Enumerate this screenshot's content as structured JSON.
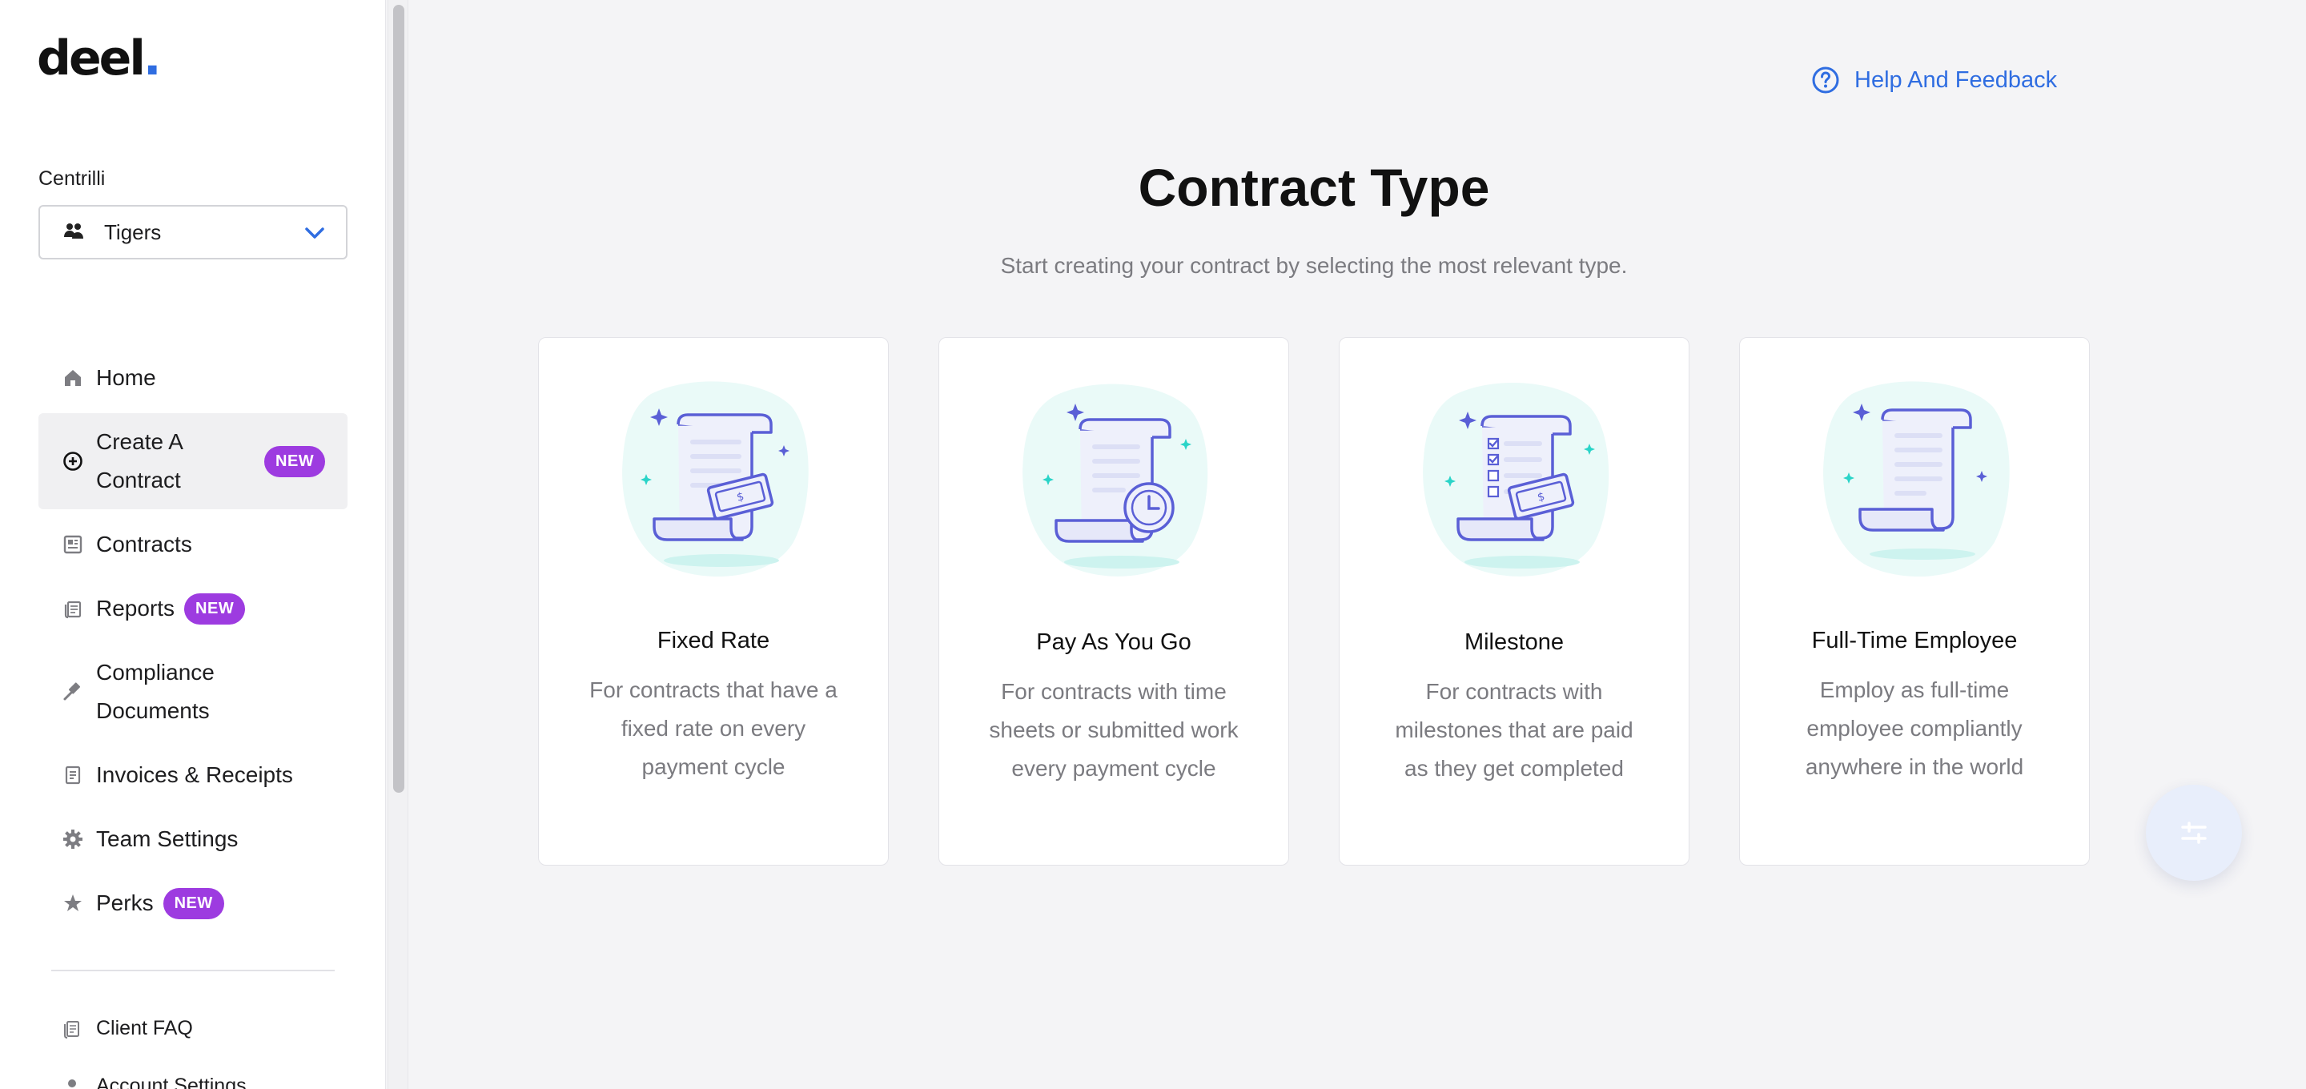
{
  "brand": {
    "logo_text": "deel",
    "logo_dot": ".",
    "accent": "#2f6de1"
  },
  "sidebar": {
    "org_name": "Centrilli",
    "team_select": {
      "value": "Tigers",
      "icon": "team-icon"
    },
    "items": [
      {
        "label": "Home",
        "icon": "home-icon",
        "badge": ""
      },
      {
        "label_line1": "Create A",
        "label_line2": "Contract",
        "icon": "plus-circle-icon",
        "badge": "NEW",
        "active": true
      },
      {
        "label": "Contracts",
        "icon": "contracts-icon",
        "badge": ""
      },
      {
        "label": "Reports",
        "icon": "reports-icon",
        "badge": "NEW"
      },
      {
        "label_line1": "Compliance",
        "label_line2": "Documents",
        "icon": "gavel-icon",
        "badge": ""
      },
      {
        "label": "Invoices & Receipts",
        "icon": "receipt-icon",
        "badge": ""
      },
      {
        "label": "Team Settings",
        "icon": "gear-icon",
        "badge": ""
      },
      {
        "label": "Perks",
        "icon": "star-icon",
        "badge": "NEW"
      }
    ],
    "footer_items": [
      {
        "label": "Client FAQ",
        "icon": "faq-icon"
      },
      {
        "label": "Account Settings",
        "icon": "user-icon"
      }
    ],
    "badge_color": "#9d3be0"
  },
  "header": {
    "help_label": "Help And Feedback"
  },
  "main": {
    "title": "Contract Type",
    "subtitle": "Start creating your contract by selecting the most relevant type.",
    "cards": [
      {
        "title": "Fixed Rate",
        "description": "For contracts that have a fixed rate on every payment cycle",
        "icon": "fixed-rate-illustration"
      },
      {
        "title": "Pay As You Go",
        "description": "For contracts with time sheets or submitted work every payment cycle",
        "icon": "pay-as-you-go-illustration"
      },
      {
        "title": "Milestone",
        "description": "For contracts with milestones that are paid as they get completed",
        "icon": "milestone-illustration"
      },
      {
        "title": "Full-Time Employee",
        "description": "Employ as full-time employee compliantly anywhere in the world",
        "icon": "full-time-employee-illustration"
      }
    ]
  }
}
